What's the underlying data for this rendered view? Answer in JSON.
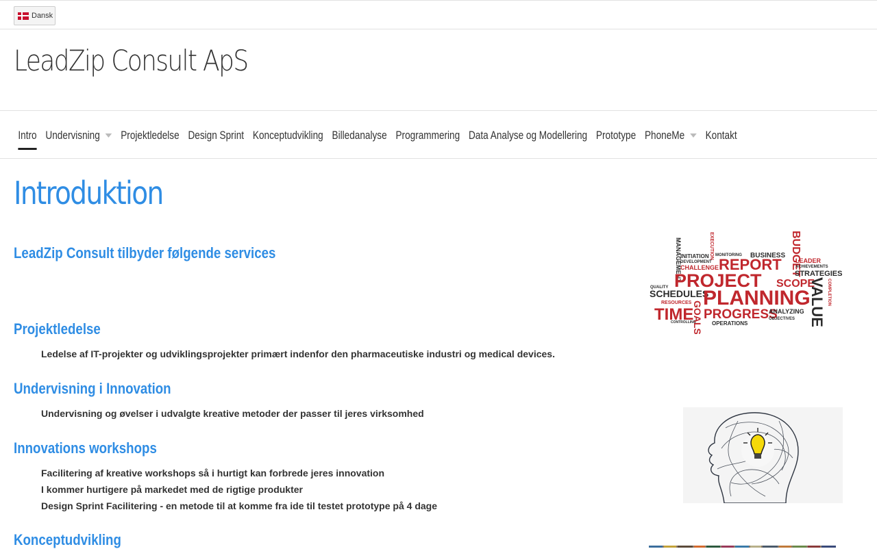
{
  "topbar": {
    "language_label": "Dansk"
  },
  "site": {
    "title": "LeadZip Consult ApS"
  },
  "nav": {
    "items": [
      {
        "label": "Intro",
        "active": true,
        "has_dropdown": false
      },
      {
        "label": "Undervisning",
        "active": false,
        "has_dropdown": true
      },
      {
        "label": "Projektledelse",
        "active": false,
        "has_dropdown": false
      },
      {
        "label": "Design Sprint",
        "active": false,
        "has_dropdown": false
      },
      {
        "label": "Konceptudvikling",
        "active": false,
        "has_dropdown": false
      },
      {
        "label": "Billedanalyse",
        "active": false,
        "has_dropdown": false
      },
      {
        "label": "Programmering",
        "active": false,
        "has_dropdown": false
      },
      {
        "label": "Data Analyse og Modellering",
        "active": false,
        "has_dropdown": false
      },
      {
        "label": "Prototype",
        "active": false,
        "has_dropdown": false
      },
      {
        "label": "PhoneMe",
        "active": false,
        "has_dropdown": true
      },
      {
        "label": "Kontakt",
        "active": false,
        "has_dropdown": false
      }
    ]
  },
  "main": {
    "heading": "Introduktion",
    "intro_subheading": "LeadZip Consult tilbyder følgende services",
    "sections": [
      {
        "title": "Projektledelse",
        "lines": [
          "Ledelse af IT-projekter og udviklingsprojekter primært indenfor den pharmaceutiske industri og medical devices."
        ]
      },
      {
        "title": "Undervisning i Innovation",
        "lines": [
          "Undervisning og øvelser i udvalgte kreative metoder der passer til jeres virksomhed"
        ]
      },
      {
        "title": "Innovations workshops",
        "lines": [
          "Facilitering af kreative workshops så i hurtigt kan forbrede jeres innovation",
          "I kommer hurtigere på markedet med de rigtige produkter",
          "Design Sprint Facilitering - en metode til at komme fra ide til testet prototype på 4 dage"
        ]
      },
      {
        "title": "Konceptudvikling",
        "lines": []
      }
    ],
    "wordcloud": {
      "words": [
        "MANAGEMENT",
        "INITIATION",
        "DEVELOPMENT",
        "CHALLENGE",
        "EXECUTION",
        "MONITORING",
        "BUSINESS",
        "BUDGET",
        "REPORT",
        "LEADER",
        "ACHIEVEMENTS",
        "STRATEGIES",
        "PROJECT",
        "SCOPE",
        "QUALITY",
        "SCHEDULES",
        "PLANNING",
        "VALUE",
        "COMPLETION",
        "RESOURCES",
        "TIME",
        "GOALS",
        "PROGRESS",
        "ANALYZING",
        "CONTROLLING",
        "OPERATIONS",
        "OBJECTIVES"
      ],
      "colors": {
        "red": "#c0272d",
        "dark": "#2b2b2b"
      }
    }
  }
}
